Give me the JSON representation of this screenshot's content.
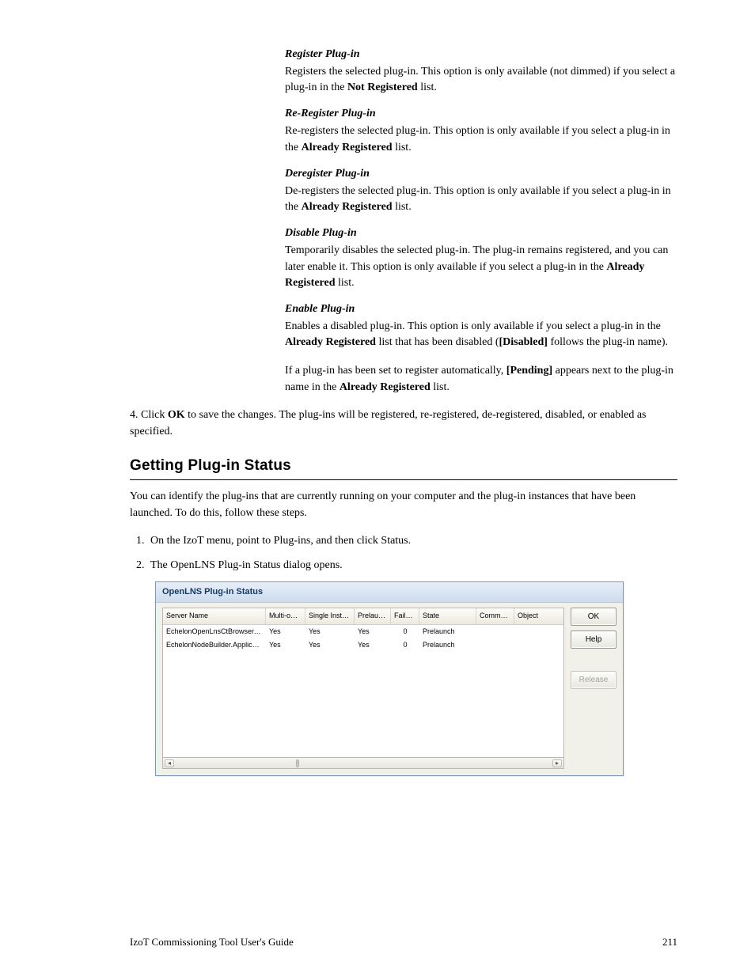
{
  "defs": [
    {
      "head": "Register Plug-in",
      "body_pre": "Registers the selected plug-in.  This option is only available (not dimmed) if you select a plug-in in the ",
      "bold1": "Not Registered",
      "body_mid": " list."
    },
    {
      "head": "Re-Register Plug-in",
      "body_pre": "Re-registers the selected plug-in.  This option is only available if you select a plug-in in the ",
      "bold1": "Already Registered",
      "body_mid": " list."
    },
    {
      "head": "Deregister Plug-in",
      "body_pre": "De-registers the selected plug-in.  This option is only available if you select a plug-in in the ",
      "bold1": "Already Registered",
      "body_mid": " list."
    },
    {
      "head": "Disable Plug-in",
      "body_pre": "Temporarily disables the selected plug-in.  The plug-in remains registered, and you can later enable it.  This option is only available if you select a plug-in in the ",
      "bold1": "Already Registered",
      "body_mid": " list."
    },
    {
      "head": "Enable Plug-in",
      "body_pre": "Enables a disabled plug-in.  This option is only available if you select a plug-in in the ",
      "bold1": "Already Registered",
      "body_mid": " list that has been disabled (",
      "bold2": "[Disabled]",
      "body_tail": " follows the plug-in name)."
    }
  ],
  "para1_pre": "If a plug-in has been set to register automatically, ",
  "para1_b1": "[Pending]",
  "para1_mid": " appears next to the plug-in name in the ",
  "para1_b2": "Already Registered",
  "para1_tail": " list.",
  "para2_pre": "4.   Click ",
  "para2_b": "OK",
  "para2_tail": " to save the changes.  The plug-ins will be registered, re-registered, de-registered, disabled, or enabled as specified.",
  "h2": "Getting Plug-in Status",
  "intro": "You can identify the plug-ins that are currently running on your computer and the plug-in instances that have been launched.  To do this, follow these steps.",
  "steps_1_pre": "On the ",
  "steps_1_b1": "IzoT",
  "steps_1_m1": " menu, point to ",
  "steps_1_b2": "Plug-ins",
  "steps_1_m2": ", and then click ",
  "steps_1_b3": "Status",
  "steps_1_tail": ".",
  "steps_2_pre": "The ",
  "steps_2_b1": "OpenLNS Plug-in Status",
  "steps_2_tail": " dialog opens.",
  "dlg_title": "OpenLNS Plug-in Status",
  "cols": {
    "name": "Server Name",
    "multi": "Multi-object?",
    "single": "Single Instance?",
    "pre": "Prelaunch?",
    "fail": "Failures",
    "state": "State",
    "cmd": "Command",
    "obj": "Object"
  },
  "rows": [
    {
      "name": "EchelonOpenLnsCtBrowser.Doc...",
      "multi": "Yes",
      "single": "Yes",
      "pre": "Yes",
      "fail": "0",
      "state": "Prelaunch",
      "cmd": "",
      "obj": ""
    },
    {
      "name": "EchelonNodeBuilder.Application",
      "multi": "Yes",
      "single": "Yes",
      "pre": "Yes",
      "fail": "0",
      "state": "Prelaunch",
      "cmd": "",
      "obj": ""
    }
  ],
  "btns": {
    "ok": "OK",
    "help": "Help",
    "release": "Release"
  },
  "footer_left": "IzoT Commissioning Tool User's Guide",
  "footer_right": "211"
}
